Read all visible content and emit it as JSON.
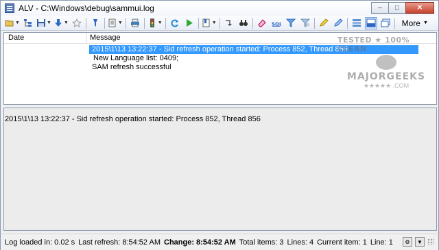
{
  "window": {
    "title": "ALV - C:\\Windows\\debug\\sammui.log"
  },
  "titlebar_buttons": {
    "minimize": "–",
    "maximize": "□",
    "close": "✕"
  },
  "toolbar": {
    "more_label": "More",
    "icons": [
      "open-icon",
      "tree-icon",
      "save-icon",
      "download-icon",
      "star-icon",
      "filter-funnel-icon",
      "page-icon",
      "print-icon",
      "traffic-light-icon",
      "refresh-icon",
      "play-icon",
      "bookmark-icon",
      "jump-icon",
      "binoculars-icon",
      "eraser-icon",
      "sql-icon",
      "filter-icon",
      "filter-clear-icon",
      "highlight-icon",
      "highlight-rules-icon",
      "columns-icon",
      "view-pane-icon",
      "window-icon"
    ]
  },
  "list": {
    "columns": {
      "date": "Date",
      "message": "Message"
    },
    "rows": [
      {
        "date": "",
        "message": "2015\\1\\13  13:22:37 - Sid refresh operation started: Process 852, Thread 856",
        "selected": true
      },
      {
        "date": "",
        "message": "New Language list: 0409;",
        "selected": false
      },
      {
        "date": "",
        "message": "SAM refresh successful",
        "selected": false
      }
    ]
  },
  "watermark": {
    "line1": "TESTED ★ 100% CLEAN",
    "line2": "MAJORGEEKS",
    "line3": "★★★★★ .COM"
  },
  "detail": {
    "text": "2015\\1\\13  13:22:37 - Sid refresh operation started: Process 852, Thread 856"
  },
  "status": {
    "log_loaded": "Log loaded in: 0.02 s",
    "last_refresh": "Last refresh: 8:54:52 AM",
    "change": "Change: 8:54:52 AM",
    "total_items": "Total items: 3",
    "lines": "Lines: 4",
    "current_item": "Current item: 1",
    "line": "Line: 1"
  },
  "colors": {
    "selection": "#3399ff",
    "titlebar": "#f3f6fb",
    "close_button": "#c7422d"
  }
}
